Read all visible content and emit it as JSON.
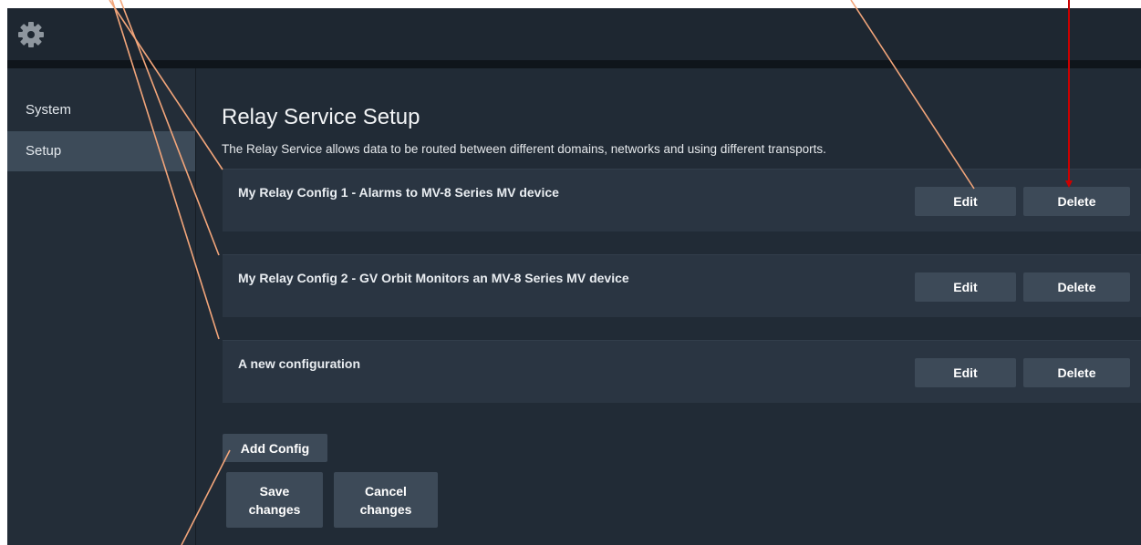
{
  "header": {
    "settings_icon": "gear-icon"
  },
  "sidebar": {
    "items": [
      {
        "label": "System",
        "active": false
      },
      {
        "label": "Setup",
        "active": true
      }
    ]
  },
  "main": {
    "title": "Relay Service Setup",
    "description": "The Relay Service allows data to be routed between different domains, networks and using different transports.",
    "configs": [
      {
        "name": "My Relay Config 1 - Alarms to MV-8 Series MV device",
        "edit_label": "Edit",
        "delete_label": "Delete"
      },
      {
        "name": "My Relay Config 2 - GV Orbit Monitors an MV-8 Series MV device",
        "edit_label": "Edit",
        "delete_label": "Delete"
      },
      {
        "name": "A new configuration",
        "edit_label": "Edit",
        "delete_label": "Delete"
      }
    ],
    "add_config_label": "Add Config",
    "save_label_line1": "Save",
    "save_label_line2": "changes",
    "cancel_label_line1": "Cancel",
    "cancel_label_line2": "changes"
  },
  "colors": {
    "background": "#212b36",
    "sidebar_active": "#3d4b59",
    "button": "#3d4a58",
    "callout_line": "#f2a57a",
    "callout_line_delete": "#cc0000"
  }
}
